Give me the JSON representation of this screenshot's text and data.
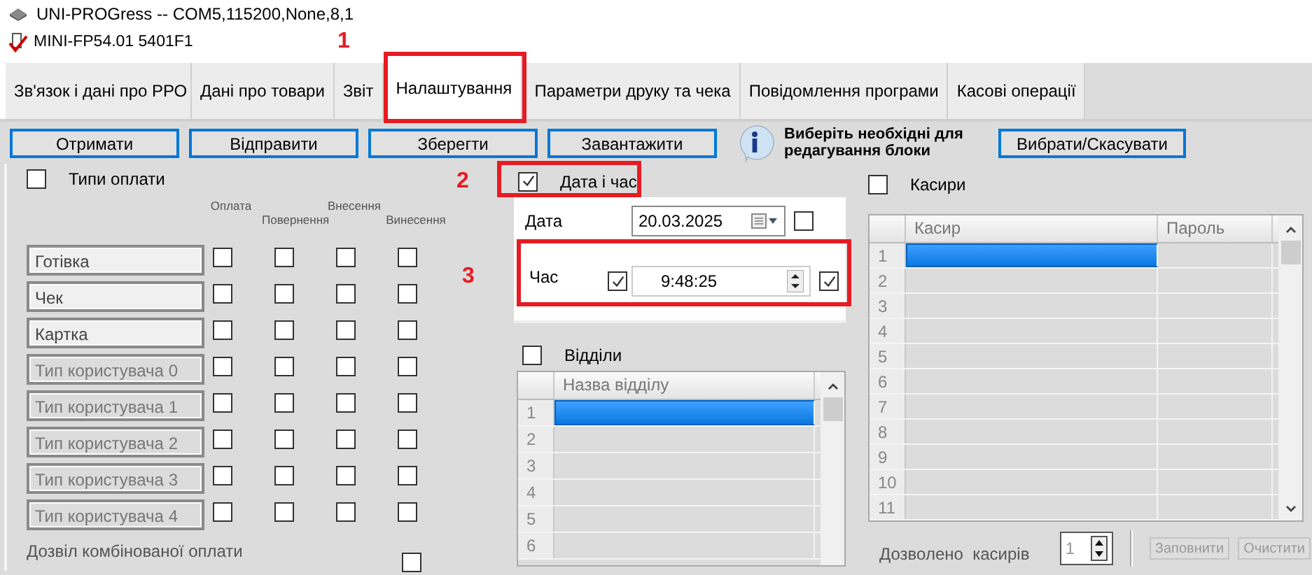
{
  "window": {
    "title": "UNI-PROGress  -- COM5,115200,None,8,1"
  },
  "device": {
    "label": "MINI-FP54.01  5401F1"
  },
  "tabs": [
    {
      "label": "Зв'язок і дані про РРО",
      "selected": false,
      "highlighted": false
    },
    {
      "label": "Дані про товари",
      "selected": false,
      "highlighted": false
    },
    {
      "label": "Звіт",
      "selected": false,
      "highlighted": false
    },
    {
      "label": "Налаштування",
      "selected": true,
      "highlighted": true
    },
    {
      "label": "Параметри друку та чека",
      "selected": false,
      "highlighted": false
    },
    {
      "label": "Повідомлення програми",
      "selected": false,
      "highlighted": false
    },
    {
      "label": "Касові операції",
      "selected": false,
      "highlighted": false
    }
  ],
  "toolbar": {
    "buttons": [
      "Отримати",
      "Відправити",
      "Зберегти",
      "Завантажити"
    ],
    "hint": "Виберіть необхідні для редагування блоки",
    "select_button": "Вибрати/Скасувати"
  },
  "payment_types": {
    "title": "Типи оплати",
    "checked": false,
    "columns": [
      "Оплата",
      "Повернення",
      "Внесення",
      "Винесення"
    ],
    "rows": [
      {
        "name": "Готівка",
        "disabled": false,
        "checks": [
          false,
          false,
          false,
          false
        ]
      },
      {
        "name": "Чек",
        "disabled": false,
        "checks": [
          false,
          false,
          false,
          false
        ]
      },
      {
        "name": "Картка",
        "disabled": false,
        "checks": [
          false,
          false,
          false,
          false
        ]
      },
      {
        "name": "Тип користувача 0",
        "disabled": true,
        "checks": [
          false,
          false,
          false,
          false
        ]
      },
      {
        "name": "Тип користувача 1",
        "disabled": true,
        "checks": [
          false,
          false,
          false,
          false
        ]
      },
      {
        "name": "Тип користувача 2",
        "disabled": true,
        "checks": [
          false,
          false,
          false,
          false
        ]
      },
      {
        "name": "Тип користувача 3",
        "disabled": true,
        "checks": [
          false,
          false,
          false,
          false
        ]
      },
      {
        "name": "Тип користувача 4",
        "disabled": true,
        "checks": [
          false,
          false,
          false,
          false
        ]
      }
    ],
    "combined": {
      "label": "Дозвіл комбінованої оплати",
      "checked": false
    }
  },
  "date_time": {
    "title": "Дата і час",
    "checked": true,
    "highlighted": true,
    "date": {
      "label": "Дата",
      "value": "20.03.2025",
      "checked": false
    },
    "time": {
      "label": "Час",
      "enabled": true,
      "value": "9:48:25",
      "checked": true,
      "highlighted": true
    }
  },
  "departments": {
    "title": "Відділи",
    "checked": false,
    "column": "Назва відділу",
    "rows": [
      {
        "number": "1",
        "selected": true
      },
      {
        "number": "2",
        "selected": false
      },
      {
        "number": "3",
        "selected": false
      },
      {
        "number": "4",
        "selected": false
      },
      {
        "number": "5",
        "selected": false
      },
      {
        "number": "6",
        "selected": false
      }
    ]
  },
  "cashiers": {
    "title": "Касири",
    "checked": false,
    "columns": [
      "Касир",
      "Пароль"
    ],
    "rows": [
      {
        "number": "1",
        "selected": true
      },
      {
        "number": "2",
        "selected": false
      },
      {
        "number": "3",
        "selected": false
      },
      {
        "number": "4",
        "selected": false
      },
      {
        "number": "5",
        "selected": false
      },
      {
        "number": "6",
        "selected": false
      },
      {
        "number": "7",
        "selected": false
      },
      {
        "number": "8",
        "selected": false
      },
      {
        "number": "9",
        "selected": false
      },
      {
        "number": "10",
        "selected": false
      },
      {
        "number": "11",
        "selected": false
      }
    ],
    "allowed_label": "Дозволено  касирів",
    "allowed_value": "1",
    "buttons": [
      {
        "label": "Заповнити",
        "disabled": true
      },
      {
        "label": "Очистити",
        "disabled": true
      }
    ]
  },
  "annotations": [
    {
      "label": "1"
    },
    {
      "label": "2"
    },
    {
      "label": "3"
    }
  ]
}
